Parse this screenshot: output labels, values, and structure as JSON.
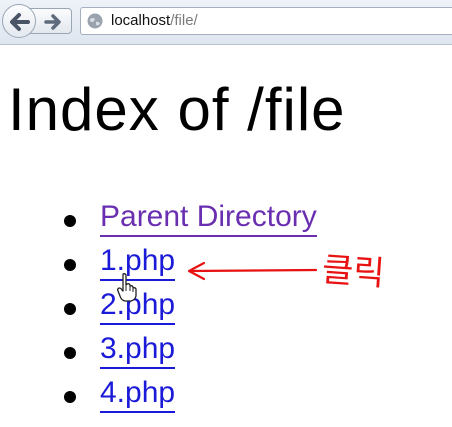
{
  "browser": {
    "url_host": "localhost",
    "url_path": "/file/"
  },
  "page": {
    "title": "Index of /file",
    "entries": [
      {
        "label": "Parent Directory",
        "visited": true
      },
      {
        "label": "1.php",
        "visited": false
      },
      {
        "label": "2.php",
        "visited": false
      },
      {
        "label": "3.php",
        "visited": false
      },
      {
        "label": "4.php",
        "visited": false
      }
    ]
  },
  "annotation": {
    "text": "클릭",
    "color": "#e81212"
  },
  "colors": {
    "link": "#1a1ad8",
    "visited_link": "#6a2fb0"
  },
  "icons": [
    "back-arrow-icon",
    "forward-arrow-icon",
    "globe-icon",
    "hand-cursor-icon"
  ]
}
